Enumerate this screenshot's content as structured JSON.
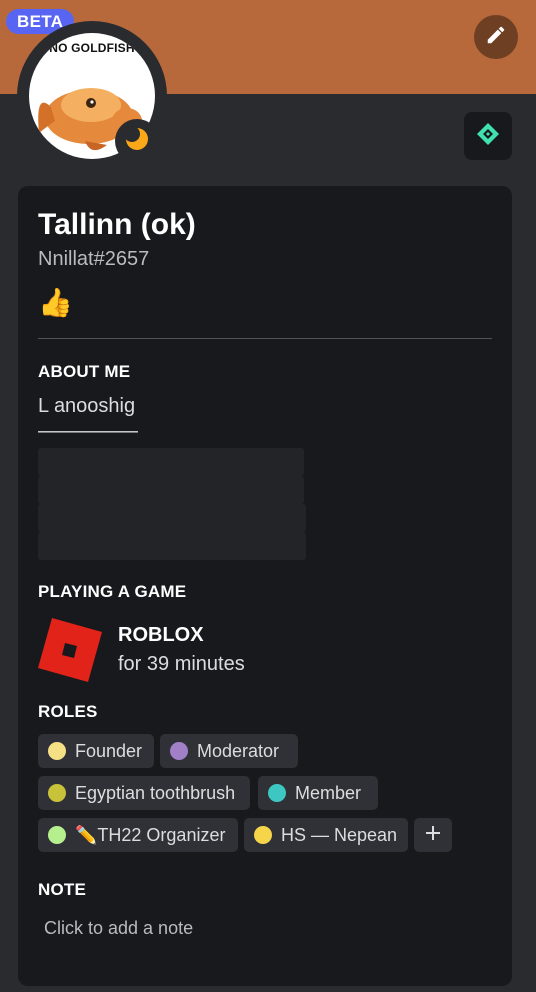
{
  "badge": {
    "beta_label": "BETA"
  },
  "avatar": {
    "caption": "NO GOLDFISH"
  },
  "user": {
    "display_name": "Tallinn (ok)",
    "tag": "Nnillat#2657",
    "custom_status_emoji": "👍"
  },
  "about_me": {
    "heading": "ABOUT ME",
    "line1": "L anooshig",
    "line2": "—————"
  },
  "activity": {
    "heading": "PLAYING A GAME",
    "game_name": "ROBLOX",
    "elapsed": "for 39 minutes"
  },
  "roles": {
    "heading": "ROLES",
    "items": [
      {
        "label": "Founder",
        "color": "#f5e085"
      },
      {
        "label": "Moderator",
        "color": "#a280c8"
      },
      {
        "label": "Egyptian toothbrush",
        "color": "#c7c23a"
      },
      {
        "label": "Member",
        "color": "#3ec7c2"
      },
      {
        "label": "✏️TH22 Organizer",
        "color": "#b6f08e"
      },
      {
        "label": "HS — Nepean",
        "color": "#f7d54a"
      }
    ]
  },
  "note": {
    "heading": "NOTE",
    "placeholder": "Click to add a note"
  },
  "colors": {
    "banner": "#b8693b",
    "card": "#18191c",
    "background": "#292b2f",
    "accent_beta": "#5865f2",
    "roblox_red": "#e2231a"
  }
}
